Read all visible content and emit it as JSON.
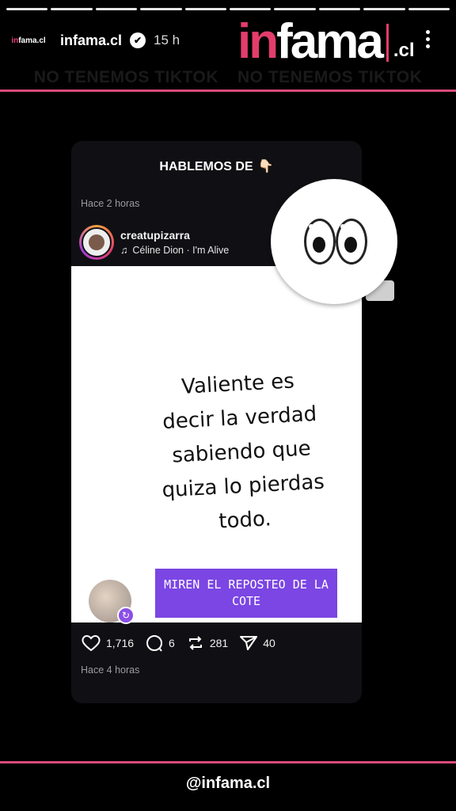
{
  "story": {
    "progress_segments": [
      1,
      1,
      1,
      1,
      1,
      1,
      1,
      1,
      1,
      1
    ],
    "username": "infama.cl",
    "verified_glyph": "✔",
    "time": "15 h",
    "avatar_text_in": "in",
    "avatar_text_rest": "fama.cl"
  },
  "brand": {
    "part_in": "in",
    "part_fama": "fama",
    "part_cl": ".cl"
  },
  "banner": {
    "left": "NO TENEMOS TIKTOK",
    "right": "NO TENEMOS TIKTOK"
  },
  "card": {
    "title": "HABLEMOS DE",
    "title_emoji": "👇🏻",
    "time_top": "Hace 2 horas",
    "post_user": "creatupizarra",
    "music_note": "♫",
    "music": "Céline Dion · I'm Alive",
    "quote_lines": [
      "Valiente es",
      "decir la verdad",
      "sabiendo que",
      "quiza lo pierdas",
      "todo."
    ],
    "repost_text": "MIREN EL REPOSTEO DE LA COTE",
    "repost_badge": "↻",
    "likes": "1,716",
    "comments": "6",
    "reposts": "281",
    "shares": "40",
    "time_bottom": "Hace 4 horas"
  },
  "footer": {
    "handle": "@infama.cl"
  },
  "icons": [
    "verified-icon",
    "music-note-icon",
    "heart-icon",
    "comment-icon",
    "repost-icon",
    "share-icon",
    "eyes-emoji-icon",
    "more-dots-icon"
  ],
  "colors": {
    "accent_pink": "#e23d6b",
    "repost_purple": "#7b46e3"
  }
}
